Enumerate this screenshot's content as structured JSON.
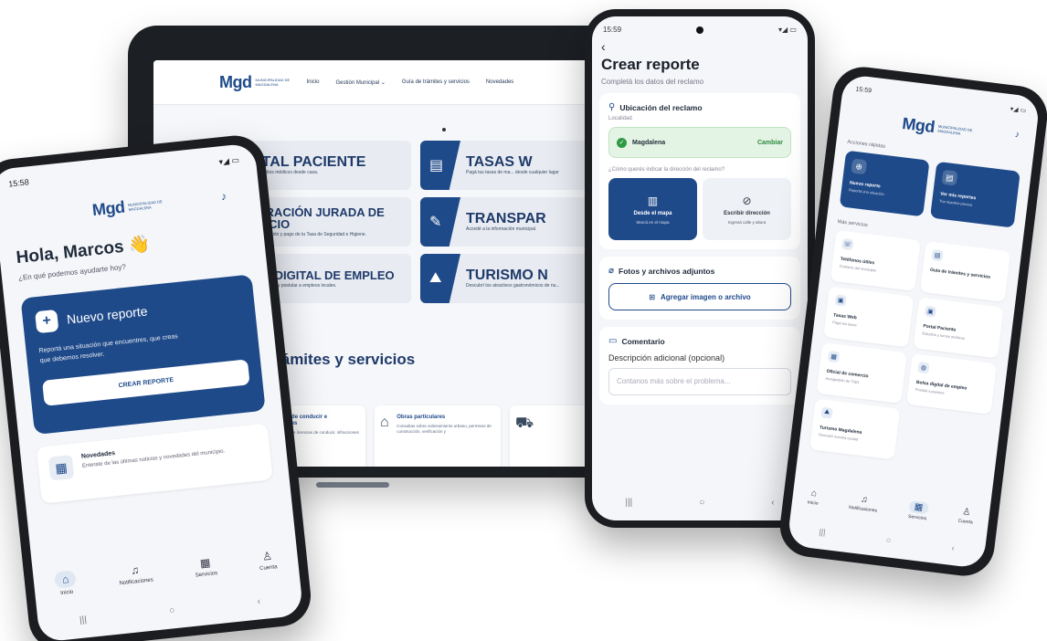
{
  "tablet": {
    "nav": {
      "logo_mark": "Mgd",
      "logo_sub": "Municipalidad de Magdalena",
      "links": [
        "Inicio",
        "Gestión Municipal ⌄",
        "Guía de trámites y servicios",
        "Novedades"
      ]
    },
    "tiles": [
      {
        "title": "PORTAL PACIENTE",
        "desc": "Consultá tus estudios médicos desde casa.",
        "icon": "clipboard-icon"
      },
      {
        "title": "TASAS W",
        "desc": "Pagá tus tasas de ma... desde cualquier lugar",
        "icon": "receipt-icon"
      },
      {
        "title": "DECLARACIÓN JURADA DE COMERCIO",
        "desc": "Autogestioná la liquidación y pago de tu Tasa de Seguridad e Higiene.",
        "icon": "check-doc-icon"
      },
      {
        "title": "TRANSPAR",
        "desc": "Accedé a la información municipal.",
        "icon": "chart-icon"
      },
      {
        "title": "BOLSA DIGITAL DE EMPLEO",
        "desc": "Un portal para publicar y postular a empleos locales.",
        "icon": "handshake-icon"
      },
      {
        "title": "TURISMO N",
        "desc": "Descubrí los atractivos gastronómicos de nu...",
        "icon": "landscape-icon"
      }
    ],
    "guia_heading": "ía de trámites y servicios",
    "services": [
      {
        "title": "Licencias de conducir e Infracciones",
        "desc": "Otorgamiento de licencias de conducir, infracciones viales,",
        "icon": "car-icon"
      },
      {
        "title": "Obras particulares",
        "desc": "Consultas sobre ordenamiento urbano, permisos de construcción, verificación y",
        "icon": "building-icon"
      },
      {
        "title": "",
        "desc": "",
        "icon": "cart-icon"
      }
    ]
  },
  "phone_left": {
    "status_time": "15:58",
    "status_icons": "▾◢ ▭",
    "logo_mark": "Mgd",
    "logo_sub": "Municipalidad de Magdalena",
    "greeting": "Hola, Marcos 👋",
    "subtitle": "¿En qué podemos ayudarte hoy?",
    "card": {
      "title": "Nuevo reporte",
      "desc": "Reportá una situación que encuentres, que creas que debemos resolver.",
      "cta": "CREAR REPORTE"
    },
    "news": {
      "title": "Novedades",
      "desc": "Enterate de las últimas noticias y novedades del municipio."
    },
    "tabs": [
      {
        "label": "Inicio",
        "icon": "home-icon",
        "glyph": "⌂",
        "active": true
      },
      {
        "label": "Notificaciones",
        "icon": "bell-icon",
        "glyph": "♫",
        "active": false
      },
      {
        "label": "Servicios",
        "icon": "grid-icon",
        "glyph": "▦",
        "active": false
      },
      {
        "label": "Cuenta",
        "icon": "user-icon",
        "glyph": "♙",
        "active": false
      }
    ],
    "sys_nav": [
      "|||",
      "○",
      "‹"
    ]
  },
  "phone_center": {
    "status_time": "15:59",
    "status_icons": "▾◢ ▭",
    "back": "‹",
    "title": "Crear reporte",
    "subtitle": "Completá los datos del reclamo",
    "location": {
      "title": "Ubicación del reclamo",
      "small": "Localidad",
      "name": "Magdalena",
      "change": "Cambiar",
      "question": "¿Cómo querés indicar la dirección del reclamo?",
      "options": [
        {
          "label": "Desde el mapa",
          "sub": "Marcá en el mapa",
          "icon": "map-icon",
          "glyph": "▥",
          "selected": true
        },
        {
          "label": "Escribir dirección",
          "sub": "Ingresá calle y altura",
          "icon": "compass-icon",
          "glyph": "⊘",
          "selected": false
        }
      ]
    },
    "attachments": {
      "title": "Fotos y archivos adjuntos",
      "button": "Agregar imagen o archivo"
    },
    "comment": {
      "title": "Comentario",
      "label": "Descripción adicional (opcional)",
      "placeholder": "Contanos más sobre el problema..."
    },
    "sys_nav": [
      "|||",
      "○",
      "‹"
    ]
  },
  "phone_right": {
    "status_time": "15:59",
    "status_icons": "▾◢ ▭",
    "logo_mark": "Mgd",
    "logo_sub": "Municipalidad de Magdalena",
    "quick_label": "Acciones rápidas",
    "quick": [
      {
        "label": "Nuevo reporte",
        "sub": "Reportá una situación",
        "icon": "plus-circle-icon",
        "glyph": "⊕"
      },
      {
        "label": "Ver mis reportes",
        "sub": "Tus reportes previos",
        "icon": "list-icon",
        "glyph": "▤"
      }
    ],
    "more_label": "Más servicios",
    "services": [
      {
        "label": "Teléfonos útiles",
        "sub": "Contacto del municipio",
        "icon": "phone-icon"
      },
      {
        "label": "Guía de trámites y servicios",
        "sub": "",
        "icon": "doc-icon"
      },
      {
        "label": "Tasas Web",
        "sub": "Pagá tus tasas",
        "icon": "receipt-icon"
      },
      {
        "label": "Portal Paciente",
        "sub": "Estudios y turnos médicos",
        "icon": "clipboard-icon"
      },
      {
        "label": "Oficial de comercio",
        "sub": "Autogestión de TISH",
        "icon": "store-icon"
      },
      {
        "label": "Bolsa digital de empleo",
        "sub": "Postulá a puestos",
        "icon": "briefcase-icon"
      },
      {
        "label": "Turismo Magdalena",
        "sub": "Descubrí nuestra ciudad",
        "icon": "landscape-icon"
      }
    ],
    "tabs": [
      {
        "label": "Inicio",
        "icon": "home-icon",
        "glyph": "⌂",
        "active": false
      },
      {
        "label": "Notificaciones",
        "icon": "bell-icon",
        "glyph": "♫",
        "active": false
      },
      {
        "label": "Servicios",
        "icon": "grid-icon",
        "glyph": "▦",
        "active": true
      },
      {
        "label": "Cuenta",
        "icon": "user-icon",
        "glyph": "♙",
        "active": false
      }
    ],
    "sys_nav": [
      "|||",
      "○",
      "‹"
    ]
  }
}
